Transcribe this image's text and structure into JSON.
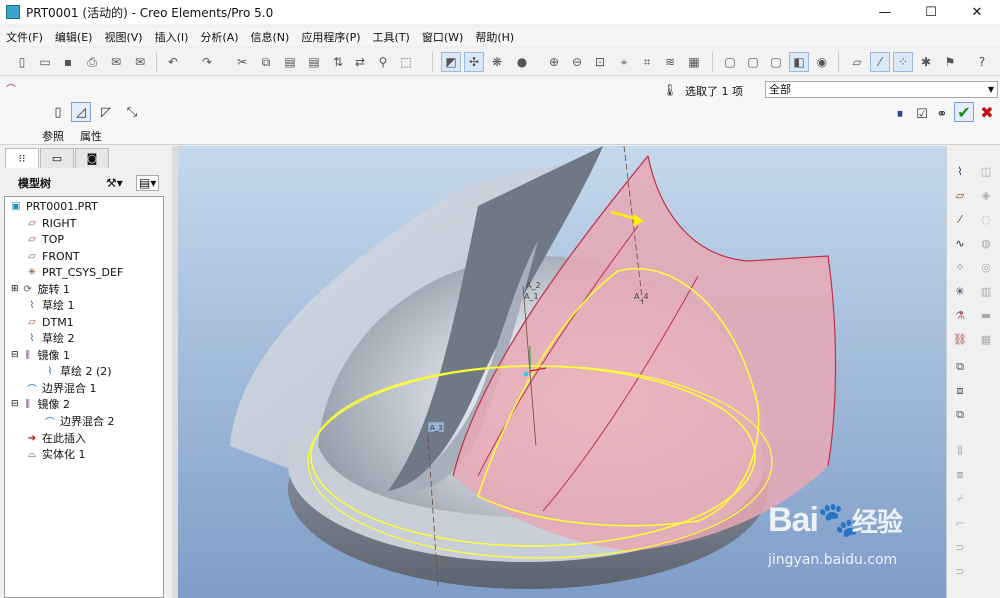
{
  "window": {
    "title": "PRT0001 (活动的) - Creo Elements/Pro 5.0",
    "minimize": "—",
    "maximize": "☐",
    "close": "✕"
  },
  "menu": [
    "文件(F)",
    "编辑(E)",
    "视图(V)",
    "插入(I)",
    "分析(A)",
    "信息(N)",
    "应用程序(P)",
    "工具(T)",
    "窗口(W)",
    "帮助(H)"
  ],
  "dashboard": {
    "tabs": [
      "参照",
      "属性"
    ],
    "selection_status": "选取了 1 项",
    "filter_value": "全部"
  },
  "model_tree": {
    "header": "模型树",
    "items": [
      {
        "label": "PRT0001.PRT",
        "icon": "part-icon"
      },
      {
        "label": "RIGHT",
        "icon": "datum-plane-icon"
      },
      {
        "label": "TOP",
        "icon": "datum-plane-icon"
      },
      {
        "label": "FRONT",
        "icon": "datum-plane-icon"
      },
      {
        "label": "PRT_CSYS_DEF",
        "icon": "csys-icon"
      },
      {
        "label": "旋转 1",
        "icon": "revolve-icon"
      },
      {
        "label": "草绘 1",
        "icon": "sketch-icon"
      },
      {
        "label": "DTM1",
        "icon": "datum-plane-icon"
      },
      {
        "label": "草绘 2",
        "icon": "sketch-icon"
      },
      {
        "label": "镜像 1",
        "icon": "mirror-icon"
      },
      {
        "label": "草绘 2 (2)",
        "icon": "sketch-icon"
      },
      {
        "label": "边界混合 1",
        "icon": "boundary-blend-icon"
      },
      {
        "label": "镜像 2",
        "icon": "mirror-icon"
      },
      {
        "label": "边界混合 2",
        "icon": "boundary-blend-icon"
      },
      {
        "label": "在此插入",
        "icon": "insert-here-icon"
      },
      {
        "label": "实体化 1",
        "icon": "solidify-icon"
      }
    ]
  },
  "viewport_labels": [
    "A_2",
    "A_1",
    "A_4",
    "A_3"
  ],
  "watermark": {
    "brand": "Bai",
    "brand_suffix": "经验",
    "url": "jingyan.baidu.com"
  },
  "colors": {
    "selected_surface": "#e8a8b4",
    "highlight_edge": "#ffff33",
    "surface": "#c7cdd6"
  }
}
